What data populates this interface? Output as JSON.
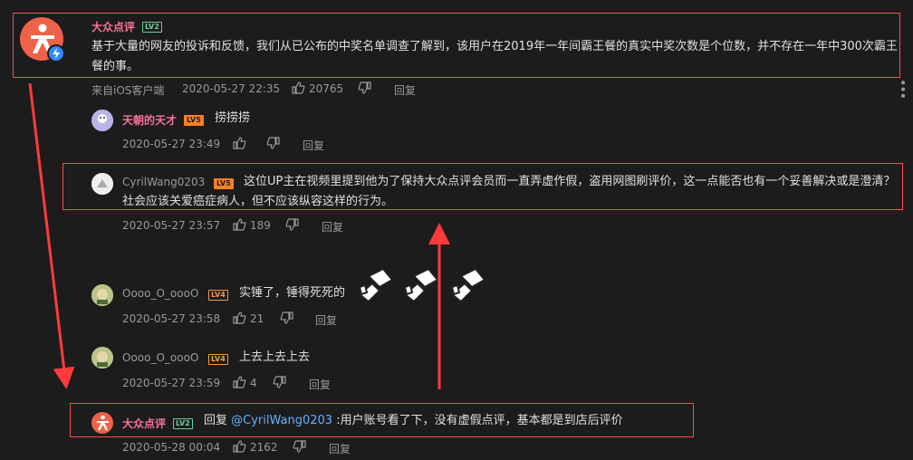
{
  "main_comment": {
    "username": "大众点评",
    "level": "LV2",
    "text": "基于大量的网友的投诉和反馈，我们从已公布的中奖名单调查了解到，该用户在2019年一年间霸王餐的真实中奖次数是个位数，并不存在一年中300次霸王餐的事。",
    "source": "来自iOS客户端",
    "time": "2020-05-27 22:35",
    "likes": "20765",
    "reply_label": "回复"
  },
  "replies": [
    {
      "username": "天朝的天才",
      "level": "LV5",
      "text": "捞捞捞",
      "time": "2020-05-27 23:49",
      "likes": "",
      "reply_label": "回复"
    },
    {
      "username": "CyrilWang0203",
      "level": "LV5",
      "text": "这位UP主在视频里提到他为了保持大众点评会员而一直弄虚作假，盗用网图刷评价，这一点能否也有一个妥善解决或是澄清？社会应该关爱癌症病人，但不应该纵容这样的行为。",
      "time": "2020-05-27 23:57",
      "likes": "189",
      "reply_label": "回复"
    },
    {
      "username": "Oooo_O_oooO",
      "level": "LV4",
      "text": "实锤了，锤得死死的",
      "time": "2020-05-27 23:58",
      "likes": "21",
      "reply_label": "回复"
    },
    {
      "username": "Oooo_O_oooO",
      "level": "LV4",
      "text": "上去上去上去",
      "time": "2020-05-27 23:59",
      "likes": "4",
      "reply_label": "回复"
    },
    {
      "username": "大众点评",
      "level": "LV2",
      "reply_prefix": "回复",
      "mention": "@CyrilWang0203",
      "text": ":用户账号看了下，没有虚假点评，基本都是到店后评价",
      "time": "2020-05-28 00:04",
      "likes": "2162",
      "reply_label": "回复"
    }
  ],
  "colors": {
    "highlight_box": "#ff4a4a",
    "arrow": "#ff3b3b",
    "username_pink": "#fb7299",
    "link_blue": "#62b3ff",
    "background": "#1c1c1c"
  },
  "icons": [
    "thumbs-up-icon",
    "thumbs-down-icon",
    "more-icon",
    "verified-icon",
    "hammer-emoji"
  ]
}
